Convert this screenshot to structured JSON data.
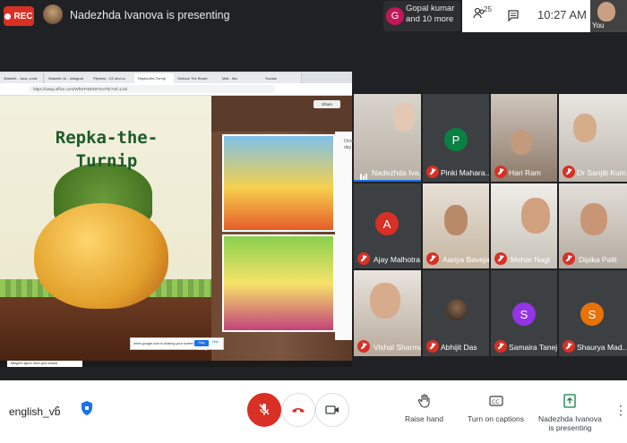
{
  "top": {
    "rec_label": "REC",
    "presenting": "Nadezhda Ivanova is presenting",
    "people_pill": {
      "initial": "G",
      "line1": "Gopal kumar",
      "line2": "and 10 more"
    },
    "participant_count": "25",
    "time": "10:27 AM",
    "self_label": "You"
  },
  "screen": {
    "tabs": [
      "Wakelet - Java, curat",
      "Wakelet: Ar - kidsgrad",
      "Flipbest - G2 and co",
      "Repka-the-Turnip",
      "Outlook The Bread",
      "Mail - Мы",
      "Sociale"
    ],
    "url": "https://sway.office.com/WfHrFIDKDFGxrTkr?ref=Link",
    "shared_label": "Share",
    "slide_title_1": "Repka-the-",
    "slide_title_2": "Turnip",
    "side_text_1": "Once",
    "side_text_2": "day",
    "notice": "meet.google.com is sharing your screen",
    "stop_sharing": "Stop sharing",
    "hide": "Hide",
    "taskbar_search": "Введите здесь текст для поиска"
  },
  "participants": [
    {
      "name": "Nadezhda Iva...",
      "speaking": true
    },
    {
      "name": "Pinki Mahara...",
      "initial": "P",
      "color": "#0b8043"
    },
    {
      "name": "Hari Ram"
    },
    {
      "name": "Dr Sanjib Kum..."
    },
    {
      "name": "Ajay Malhotra",
      "initial": "A",
      "color": "#d93025"
    },
    {
      "name": "Aariya Baveja"
    },
    {
      "name": "Mehar Nagi"
    },
    {
      "name": "Dipika Palit"
    },
    {
      "name": "Vishal Sharma"
    },
    {
      "name": "Abhijit Das"
    },
    {
      "name": "Samaira Taneja",
      "initial": "S",
      "color": "#9334e6"
    },
    {
      "name": "Shaurya Mad...",
      "initial": "S",
      "color": "#e8710a"
    }
  ],
  "bottom": {
    "meeting_code": "english_vb",
    "raise_hand": "Raise hand",
    "captions": "Turn on captions",
    "presenting_1": "Nadezhda Ivanova",
    "presenting_2": "is presenting"
  }
}
